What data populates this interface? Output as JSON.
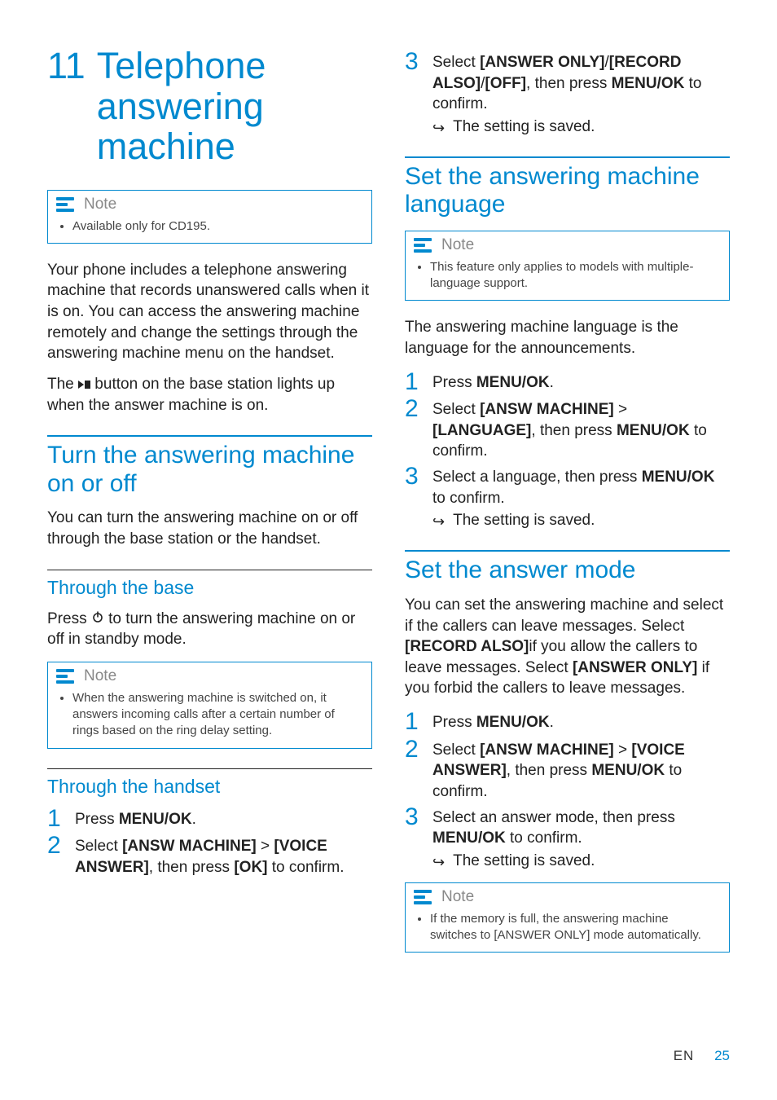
{
  "chapter": {
    "number": "11",
    "title": "Telephone answering machine"
  },
  "note_label": "Note",
  "result_arrow": "↪",
  "col1": {
    "note1": "Available only for CD195.",
    "intro_a": "Your phone includes a telephone answering machine that records unanswered calls when it is on. You can access the answering machine remotely and change the settings through the answering machine menu on the handset.",
    "intro_b_pre": "The ",
    "intro_b_post": " button on the base station lights up when the answer machine is on.",
    "sec1_title": "Turn the answering machine on or off",
    "sec1_body": "You can turn the answering machine on or off through the base station or the handset.",
    "sub1_title": "Through the base",
    "sub1_body_pre": "Press ",
    "sub1_body_post": " to turn the answering machine on or off in standby mode.",
    "note2": "When the answering machine is switched on, it answers incoming calls after a certain number of rings based on the ring delay setting.",
    "sub2_title": "Through the handset",
    "steps_a": {
      "s1_pre": "Press ",
      "s1_b": "MENU/OK",
      "s1_post": ".",
      "s2_pre": "Select ",
      "s2_b1": "[ANSW MACHINE]",
      "s2_mid": " > ",
      "s2_b2": "[VOICE ANSWER]",
      "s2_mid2": ", then press ",
      "s2_b3": "[OK]",
      "s2_post": " to confirm."
    }
  },
  "col2": {
    "s3_pre": "Select ",
    "s3_b1": "[ANSWER ONLY]",
    "s3_sep": "/",
    "s3_b2": "[RECORD ALSO]",
    "s3_b3": "[OFF]",
    "s3_mid": ", then press ",
    "s3_b4": "MENU/OK",
    "s3_post": " to confirm.",
    "result1": "The setting is saved.",
    "sec2_title": "Set the answering machine language",
    "note3": "This feature only applies to models with multiple-language support.",
    "sec2_body": "The answering machine language is the language for the announcements.",
    "steps_b": {
      "s1_pre": "Press ",
      "s1_b": "MENU/OK",
      "s1_post": ".",
      "s2_pre": "Select ",
      "s2_b1": "[ANSW MACHINE]",
      "s2_mid": " > ",
      "s2_b2": "[LANGUAGE]",
      "s2_mid2": ", then press ",
      "s2_b3": "MENU/OK",
      "s2_post": " to confirm.",
      "s3_pre": "Select a language, then press ",
      "s3_b": "MENU/OK",
      "s3_post": " to confirm."
    },
    "result2": "The setting is saved.",
    "sec3_title": "Set the answer mode",
    "sec3_body_a": "You can set the answering machine and select if the callers can leave messages. Select ",
    "sec3_body_b": "[RECORD ALSO]",
    "sec3_body_c": "if you allow the callers to leave messages. Select ",
    "sec3_body_d": "[ANSWER ONLY]",
    "sec3_body_e": " if you forbid the callers to leave messages.",
    "steps_c": {
      "s1_pre": "Press ",
      "s1_b": "MENU/OK",
      "s1_post": ".",
      "s2_pre": "Select ",
      "s2_b1": "[ANSW MACHINE]",
      "s2_mid": " > ",
      "s2_b2": "[VOICE ANSWER]",
      "s2_mid2": ", then press ",
      "s2_b3": "MENU/OK",
      "s2_post": " to confirm.",
      "s3_pre": "Select an answer mode, then press ",
      "s3_b": "MENU/OK",
      "s3_post": " to confirm."
    },
    "result3": "The setting is saved.",
    "note4": "If the memory is full, the answering machine switches to [ANSWER ONLY] mode automatically."
  },
  "footer": {
    "lang": "EN",
    "page": "25"
  }
}
